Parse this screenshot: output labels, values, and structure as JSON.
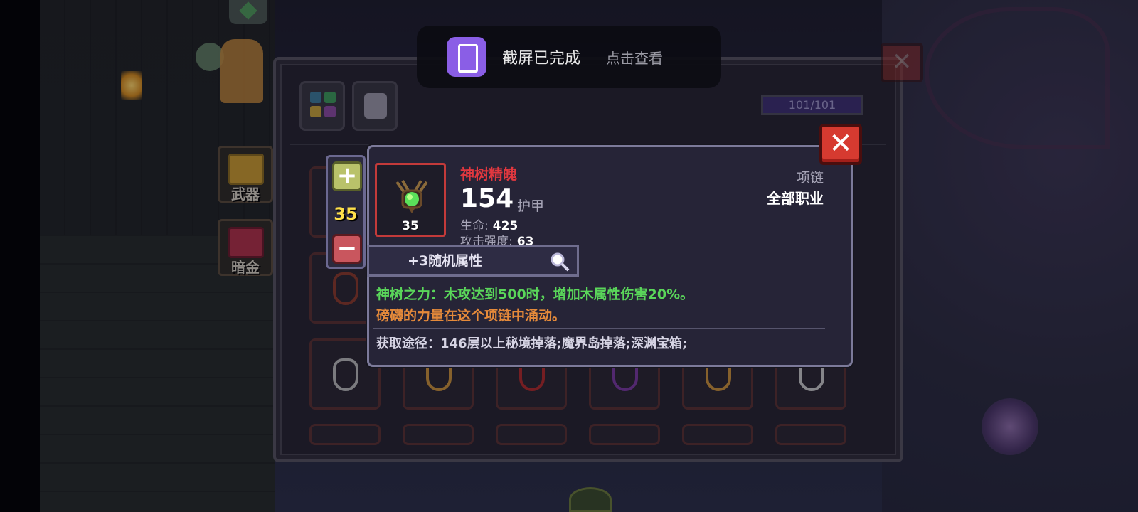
{
  "toast": {
    "title": "截屏已完成",
    "action": "点击查看"
  },
  "side_tabs": [
    {
      "label": "武器"
    },
    {
      "label": "暗金"
    }
  ],
  "inventory": {
    "capacity": "101/101",
    "close_icon": "✕"
  },
  "stepper": {
    "plus": "+",
    "level": "35",
    "minus": "−"
  },
  "tooltip": {
    "item_name": "神树精魄",
    "item_level": "35",
    "armor_value": "154",
    "armor_label": "护甲",
    "stats": [
      {
        "key": "生命:",
        "value": "425"
      },
      {
        "key": "攻击强度:",
        "value": "63"
      }
    ],
    "slot_type": "项链",
    "class_req": "全部职业",
    "random_attr": "+3随机属性",
    "effect": "神树之力：木攻达到500时，增加木属性伤害20%。",
    "flavor": "磅礴的力量在这个项链中涌动。",
    "source": "获取途径：146层以上秘境掉落;魔界岛掉落;深渊宝箱;",
    "close_icon": "✕"
  },
  "colors": {
    "item_name": "#e2383f",
    "level": "#ffe04a",
    "effect": "#5ad65a",
    "flavor": "#e58a3a"
  }
}
